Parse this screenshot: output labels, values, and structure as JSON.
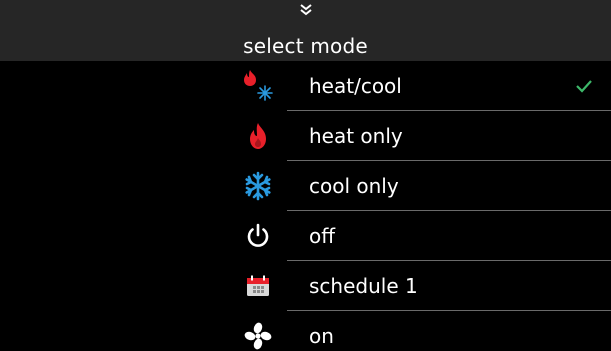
{
  "header": {
    "collapse_icon": "double-chevron-down-icon",
    "title": "select mode"
  },
  "modes": [
    {
      "label": "heat/cool",
      "icon": "heat-cool-icon",
      "selected": true
    },
    {
      "label": "heat only",
      "icon": "flame-icon",
      "selected": false
    },
    {
      "label": "cool only",
      "icon": "snowflake-icon",
      "selected": false
    },
    {
      "label": "off",
      "icon": "power-icon",
      "selected": false
    },
    {
      "label": "schedule 1",
      "icon": "calendar-icon",
      "selected": false
    },
    {
      "label": "on",
      "icon": "fan-icon",
      "selected": false
    }
  ],
  "colors": {
    "heat": "#e8202a",
    "cool": "#2a9ae0",
    "check": "#3db86a",
    "header_bg": "#262626"
  }
}
